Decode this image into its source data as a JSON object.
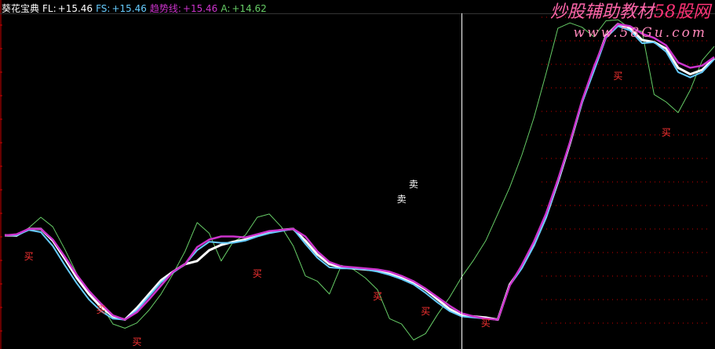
{
  "header": {
    "indicator_name": "葵花宝典",
    "fl_label": "FL:",
    "fl_value": "+15.46",
    "fs_label": "FS:",
    "fs_value": "+15.46",
    "trend_label": "趋势线:",
    "trend_value": "+15.46",
    "a_label": "A:",
    "a_value": "+14.62"
  },
  "watermark": {
    "title_a": "炒股辅助教材",
    "title_b": "58股网",
    "url": "www.58Gu.com",
    "tick_mark": "~"
  },
  "signals": {
    "buy_text": "买",
    "sell_text": "卖"
  },
  "colors": {
    "background": "#000000",
    "white_line": "#ffffff",
    "blue_line": "#66ccff",
    "magenta_line": "#cc33cc",
    "green_line": "#66cc66",
    "buy_signal": "#ff3333",
    "sell_signal": "#ffffff",
    "cursor_line": "#ffffff",
    "grid_dash": "#cc0000",
    "label_text": "#ffffff",
    "watermark_title": "#ff66aa",
    "watermark_url": "#ff88bb"
  },
  "chart_data": {
    "type": "line",
    "series": [
      {
        "name": "FL",
        "values": [
          7.0,
          7.0,
          7.6,
          7.6,
          6.5,
          4.8,
          3.0,
          1.5,
          0.3,
          -0.6,
          -0.9,
          0.2,
          1.5,
          2.8,
          3.6,
          4.3,
          4.6,
          5.6,
          6.1,
          6.4,
          6.6,
          7.0,
          7.3,
          7.5,
          7.6,
          6.5,
          5.2,
          4.3,
          4.0,
          3.9,
          3.8,
          3.7,
          3.4,
          3.0,
          2.6,
          1.9,
          1.0,
          0.1,
          -0.5,
          -0.6,
          -0.7,
          -0.9,
          2.4,
          4.0,
          6.1,
          8.7,
          12.0,
          15.6,
          19.5,
          22.6,
          25.7,
          26.8,
          26.4,
          25.3,
          25.1,
          24.5,
          22.7,
          22.1,
          22.5,
          23.6
        ]
      },
      {
        "name": "FS",
        "values": [
          7.0,
          7.0,
          7.5,
          7.3,
          6.0,
          4.2,
          2.5,
          1.0,
          -0.1,
          -0.8,
          -0.9,
          0.0,
          1.3,
          2.6,
          3.5,
          4.3,
          5.6,
          6.4,
          6.3,
          6.3,
          6.5,
          6.9,
          7.2,
          7.4,
          7.6,
          6.2,
          4.9,
          4.0,
          3.9,
          3.9,
          3.8,
          3.6,
          3.3,
          2.9,
          2.4,
          1.6,
          0.7,
          -0.1,
          -0.6,
          -0.7,
          -0.8,
          -0.9,
          2.3,
          3.9,
          6.0,
          8.6,
          12.0,
          15.6,
          19.4,
          22.4,
          25.5,
          26.6,
          26.2,
          25.0,
          25.1,
          24.2,
          22.3,
          21.8,
          22.3,
          23.5
        ]
      },
      {
        "name": "趋势线",
        "values": [
          7.0,
          7.1,
          7.6,
          7.6,
          6.6,
          5.0,
          3.3,
          1.8,
          0.6,
          -0.5,
          -0.9,
          -0.2,
          1.0,
          2.3,
          3.6,
          4.3,
          5.9,
          6.6,
          6.9,
          6.9,
          6.8,
          7.1,
          7.4,
          7.5,
          7.6,
          6.9,
          5.5,
          4.5,
          4.1,
          4.0,
          3.9,
          3.8,
          3.6,
          3.2,
          2.7,
          2.0,
          1.2,
          0.4,
          -0.3,
          -0.6,
          -0.8,
          -0.9,
          2.3,
          4.2,
          6.4,
          9.0,
          12.2,
          15.7,
          19.6,
          22.8,
          25.6,
          26.8,
          26.6,
          25.9,
          25.5,
          24.8,
          23.2,
          22.7,
          22.9,
          23.7
        ]
      },
      {
        "name": "A",
        "values": [
          7.0,
          6.9,
          7.7,
          8.7,
          7.8,
          5.7,
          3.4,
          1.5,
          0.5,
          -1.3,
          -1.7,
          -1.2,
          0.0,
          1.5,
          3.4,
          5.5,
          8.2,
          7.2,
          4.6,
          6.4,
          7.0,
          8.7,
          9.0,
          7.8,
          6.0,
          3.2,
          2.7,
          1.5,
          4.2,
          3.8,
          3.0,
          1.9,
          -0.8,
          -1.3,
          -2.8,
          -2.2,
          -0.4,
          1.2,
          3.1,
          4.7,
          6.5,
          9.0,
          11.5,
          14.5,
          18.0,
          22.1,
          26.4,
          26.9,
          26.5,
          25.6,
          27.1,
          27.2,
          26.4,
          26.1,
          20.2,
          19.5,
          18.5,
          20.6,
          23.4,
          24.7
        ]
      }
    ],
    "cursor": {
      "index": 38
    },
    "buy_signals": [
      {
        "index": 2,
        "value": 5.0
      },
      {
        "index": 8,
        "value": 0.0
      },
      {
        "index": 11,
        "value": -3.0
      },
      {
        "index": 21,
        "value": 3.4
      },
      {
        "index": 31,
        "value": 1.3
      },
      {
        "index": 35,
        "value": -0.1
      },
      {
        "index": 40,
        "value": -1.2
      },
      {
        "index": 51,
        "value": 21.9
      },
      {
        "index": 55,
        "value": 16.6
      }
    ],
    "sell_signals": [
      {
        "index": 34,
        "value": 11.8
      },
      {
        "index": 33,
        "value": 10.4
      }
    ],
    "ylim": [
      -3.5,
      27.8
    ],
    "grid": true
  }
}
